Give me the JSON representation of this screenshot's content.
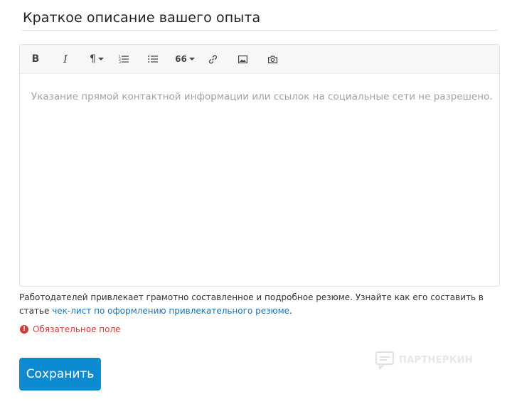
{
  "section": {
    "title": "Краткое описание вашего опыта"
  },
  "editor": {
    "toolbar": {
      "bold": "B",
      "italic": "I",
      "paragraph": "¶",
      "quote": "66"
    },
    "placeholder": "Указание прямой контактной информации или ссылок на социальные сети не разрешено."
  },
  "hint": {
    "text": "Работодателей привлекает грамотно составленное и подробное резюме. Узнайте как его составить в статье ",
    "link": "чек-лист по оформлению привлекательного резюме",
    "suffix": "."
  },
  "error": {
    "icon": "!",
    "text": "Обязательное поле"
  },
  "actions": {
    "save_label": "Сохранить"
  },
  "watermark": {
    "text": "ПАРТНЕРКИН"
  },
  "colors": {
    "primary": "#0c8bd0",
    "error": "#d23c3c",
    "link": "#1b73b6"
  }
}
